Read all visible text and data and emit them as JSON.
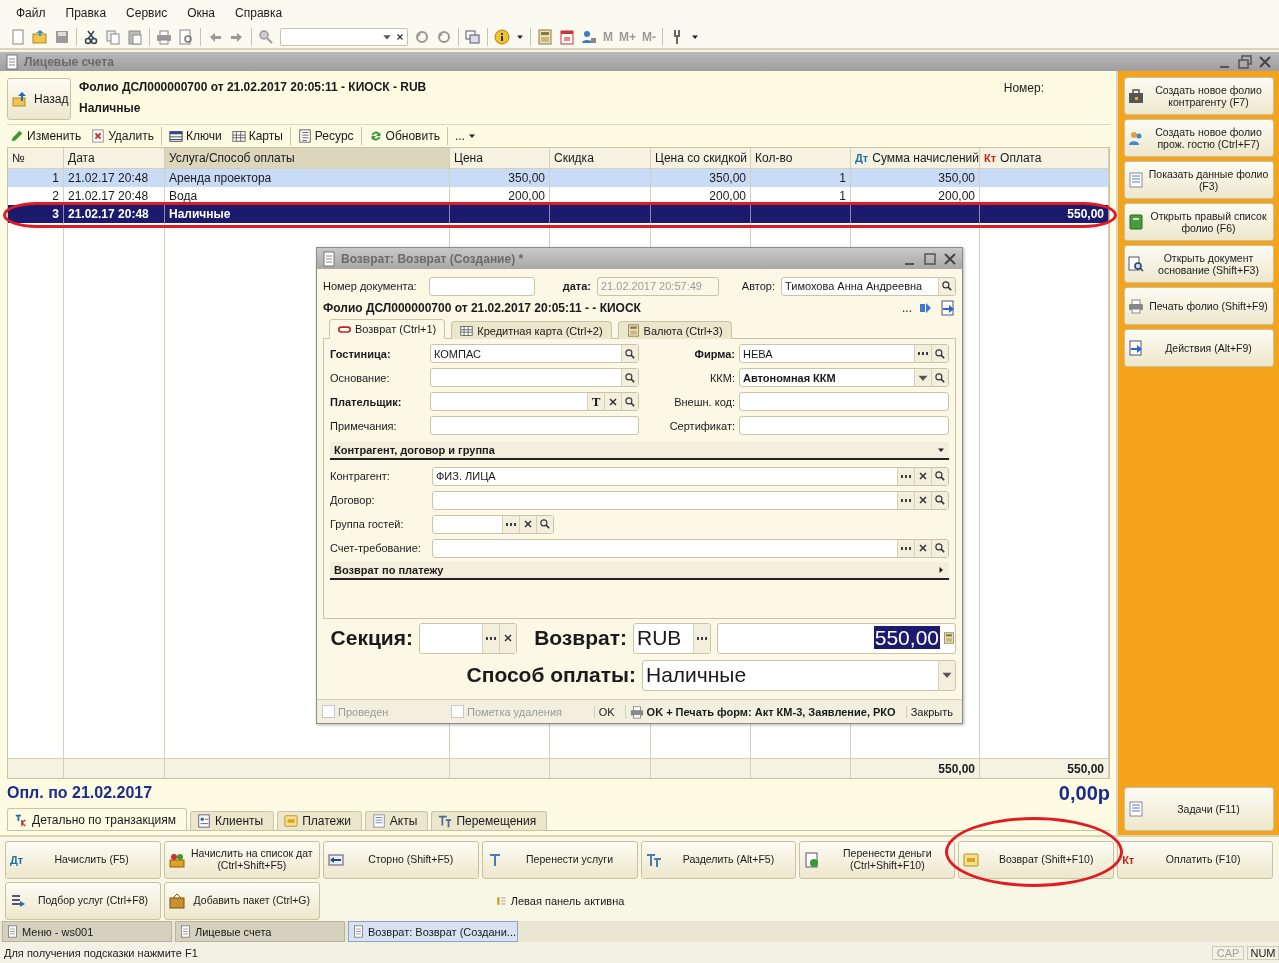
{
  "menu": [
    {
      "label": "Файл"
    },
    {
      "label": "Правка"
    },
    {
      "label": "Сервис"
    },
    {
      "label": "Окна"
    },
    {
      "label": "Справка"
    }
  ],
  "toolbar": {
    "memory_buttons": [
      "M",
      "M+",
      "M-"
    ]
  },
  "window": {
    "title": "Лицевые счета"
  },
  "header": {
    "back_button": "Назад",
    "folio_title": "Фолио ДСЛ000000700 от 21.02.2017 20:05:11 - КИОСК - RUB",
    "payment": "Наличные",
    "number_label": "Номер:"
  },
  "list_toolbar": [
    {
      "kind": "edit",
      "label": "Изменить"
    },
    {
      "kind": "delete",
      "label": "Удалить"
    },
    {
      "kind": "keys",
      "label": "Ключи"
    },
    {
      "kind": "cards",
      "label": "Карты"
    },
    {
      "kind": "resource",
      "label": "Ресурс"
    },
    {
      "kind": "refresh",
      "label": "Обновить"
    },
    {
      "kind": "more",
      "label": "..."
    }
  ],
  "table": {
    "columns": [
      {
        "kind": "plain",
        "label": "№",
        "sorted": false
      },
      {
        "kind": "plain",
        "label": "Дата",
        "sorted": false
      },
      {
        "kind": "plain",
        "label": "Услуга/Способ оплаты",
        "sorted": true
      },
      {
        "kind": "plain",
        "label": "Цена",
        "sorted": false
      },
      {
        "kind": "plain",
        "label": "Скидка",
        "sorted": false
      },
      {
        "kind": "plain",
        "label": "Цена со скидкой",
        "sorted": false
      },
      {
        "kind": "plain",
        "label": "Кол-во",
        "sorted": false
      },
      {
        "kind": "debit",
        "marker": "Дт",
        "label": "Сумма начислений",
        "sorted": false
      },
      {
        "kind": "credit",
        "marker": "Кт",
        "label": "Оплата",
        "sorted": false
      }
    ],
    "rows": [
      {
        "kind": "service",
        "highlighted": true,
        "selected": false,
        "no": "1",
        "date": "21.02.17 20:48",
        "service": "Аренда проектора",
        "price": "350,00",
        "discounted": "350,00",
        "qty": "1",
        "charges": "350,00"
      },
      {
        "kind": "service",
        "highlighted": false,
        "selected": false,
        "no": "2",
        "date": "21.02.17 20:48",
        "service": "Вода",
        "price": "200,00",
        "discounted": "200,00",
        "qty": "1",
        "charges": "200,00"
      },
      {
        "kind": "payment",
        "highlighted": false,
        "selected": true,
        "no": "3",
        "date": "21.02.17 20:48",
        "service": "Наличные",
        "payment": "550,00"
      }
    ],
    "totals": {
      "charges": "550,00",
      "payment": "550,00"
    }
  },
  "summary": {
    "label": "Опл. по 21.02.2017",
    "amount": "0,00р"
  },
  "bottom_tabs": [
    {
      "label": "Детально по транзакциям",
      "selected": true
    },
    {
      "label": "Клиенты",
      "selected": false
    },
    {
      "label": "Платежи",
      "selected": false
    },
    {
      "label": "Акты",
      "selected": false
    },
    {
      "label": "Перемещения",
      "selected": false
    }
  ],
  "right_panel": {
    "buttons": [
      {
        "label": "Создать новое фолио контрагенту (F7)"
      },
      {
        "label": "Создать новое фолио прож. гостю (Ctrl+F7)"
      },
      {
        "label": "Показать данные фолио (F3)"
      },
      {
        "label": "Открыть правый список фолио (F6)"
      },
      {
        "label": "Открыть документ основание (Shift+F3)"
      },
      {
        "label": "Печать фолио (Shift+F9)"
      },
      {
        "label": "Действия (Alt+F9)"
      }
    ],
    "tasks_button": {
      "label": "Задачи (F11)"
    }
  },
  "action_buttons": [
    [
      {
        "kind": "debit",
        "marker": "Дт",
        "label": "Начислить (F5)"
      },
      {
        "kind": "icon",
        "label": "Начислить на список дат\n(Ctrl+Shift+F5)"
      },
      {
        "kind": "icon",
        "label": "Сторно (Shift+F5)"
      },
      {
        "kind": "icon",
        "label": "Перенести услуги"
      },
      {
        "kind": "icon",
        "label": "Разделить (Alt+F5)"
      },
      {
        "kind": "icon",
        "label": "Перенести деньги\n(Ctrl+Shift+F10)"
      },
      {
        "kind": "icon",
        "label": "Возврат (Shift+F10)"
      },
      {
        "kind": "credit",
        "marker": "Кт",
        "label": "Оплатить (F10)"
      }
    ],
    [
      {
        "kind": "icon",
        "label": "Подбор услуг (Ctrl+F8)"
      },
      {
        "kind": "icon",
        "label": "Добавить пакет (Ctrl+G)"
      }
    ]
  ],
  "panel_status": "Левая панель активна",
  "taskbar": [
    {
      "label": "Меню - ws001",
      "selected": false
    },
    {
      "label": "Лицевые счета",
      "selected": false
    },
    {
      "label": "Возврат: Возврат (Создани...",
      "selected": true
    }
  ],
  "status_bar": {
    "hint": "Для получения подсказки нажмите F1",
    "indicators": [
      {
        "label": "CAP",
        "on": false
      },
      {
        "label": "NUM",
        "on": true
      }
    ]
  },
  "dialog": {
    "title": "Возврат: Возврат (Создание) *",
    "doc_number_label": "Номер документа:",
    "date_label": "дата:",
    "date_value": "21.02.2017 20:57:49",
    "date_disabled": true,
    "author_label": "Автор:",
    "author_value": "Тимохова Анна Андреевна",
    "folio": "Фолио ДСЛ000000700 от 21.02.2017 20:05:11 - - КИОСК",
    "folio_more": "...",
    "tabs": [
      {
        "label": "Возврат (Ctrl+1)",
        "selected": true
      },
      {
        "label": "Кредитная карта (Ctrl+2)",
        "selected": false
      },
      {
        "label": "Валюта (Ctrl+3)",
        "selected": false
      }
    ],
    "fields": [
      {
        "label": "Гостиница:",
        "bold": true,
        "value": "КОМПАС",
        "buttons": [
          {
            "kind": "search"
          }
        ]
      },
      {
        "label": "Фирма:",
        "bold": true,
        "value": "НЕВА",
        "buttons": [
          {
            "kind": "dots"
          },
          {
            "kind": "search"
          }
        ]
      },
      {
        "label": "Основание:",
        "bold": false,
        "buttons": [
          {
            "kind": "search"
          }
        ]
      },
      {
        "label": "ККМ:",
        "bold": false,
        "value": "Автономная ККМ",
        "value_bold": true,
        "buttons": [
          {
            "kind": "dropdown"
          },
          {
            "kind": "search"
          }
        ]
      },
      {
        "label": "Плательщик:",
        "bold": true,
        "buttons": [
          {
            "kind": "letter",
            "label": "T"
          },
          {
            "kind": "clear"
          },
          {
            "kind": "search"
          }
        ]
      },
      {
        "label": "Внешн. код:",
        "bold": false
      },
      {
        "label": "Примечания:",
        "bold": false
      },
      {
        "label": "Сертификат:",
        "bold": false
      }
    ],
    "sections": [
      {
        "title": "Контрагент, договор и группа",
        "expanded": true,
        "fields": [
          {
            "label": "Контрагент:",
            "value": "ФИЗ. ЛИЦА",
            "wide": true,
            "buttons": [
              {
                "kind": "dots"
              },
              {
                "kind": "clear"
              },
              {
                "kind": "search"
              }
            ]
          },
          {
            "label": "Договор:",
            "wide": true,
            "buttons": [
              {
                "kind": "dots"
              },
              {
                "kind": "clear"
              },
              {
                "kind": "search"
              }
            ]
          },
          {
            "label": "Группа гостей:",
            "wide": false,
            "buttons": [
              {
                "kind": "dots"
              },
              {
                "kind": "clear"
              },
              {
                "kind": "search"
              }
            ]
          },
          {
            "label": "Счет-требование:",
            "wide": true,
            "buttons": [
              {
                "kind": "dots"
              },
              {
                "kind": "clear"
              },
              {
                "kind": "search"
              }
            ]
          }
        ]
      },
      {
        "title": "Возврат по платежу",
        "expanded": false
      }
    ],
    "section_label": "Секция:",
    "return_label": "Возврат:",
    "currency": "RUB",
    "amount": "550,00",
    "amount_selected": true,
    "method_label": "Способ оплаты:",
    "method": "Наличные",
    "checkboxes": [
      {
        "label": "Проведен",
        "checked": false,
        "disabled": true
      },
      {
        "label": "Пометка удаления",
        "checked": false,
        "disabled": true
      }
    ],
    "buttons": [
      {
        "label": "OK",
        "bold": false
      },
      {
        "label": "OK + Печать форм: Акт КМ-3, Заявление, РКО",
        "bold": true
      },
      {
        "label": "Закрыть",
        "bold": false
      }
    ]
  }
}
